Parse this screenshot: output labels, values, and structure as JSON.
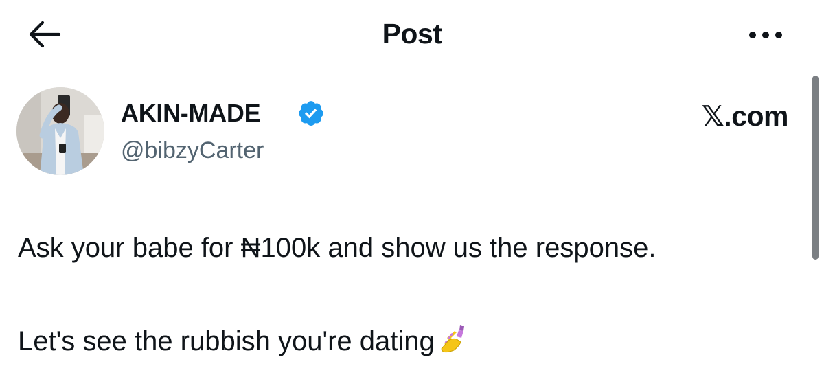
{
  "header": {
    "title": "Post"
  },
  "author": {
    "name": "AKIN-MADE",
    "handle": "@bibzyCarter",
    "verified": true
  },
  "source_label": "𝕏.com",
  "tweet": {
    "line_1": "Ask your babe for ₦100k and show us the response.",
    "line_2": "Let's see the rubbish you're dating"
  },
  "icons": {
    "back": "back-arrow-icon",
    "more": "more-horizontal-icon",
    "verified": "verified-badge-icon",
    "emoji": "nail-polish-emoji"
  },
  "colors": {
    "text_primary": "#0f1419",
    "text_secondary": "#536471",
    "verified_blue": "#1d9bf0",
    "background": "#ffffff"
  }
}
